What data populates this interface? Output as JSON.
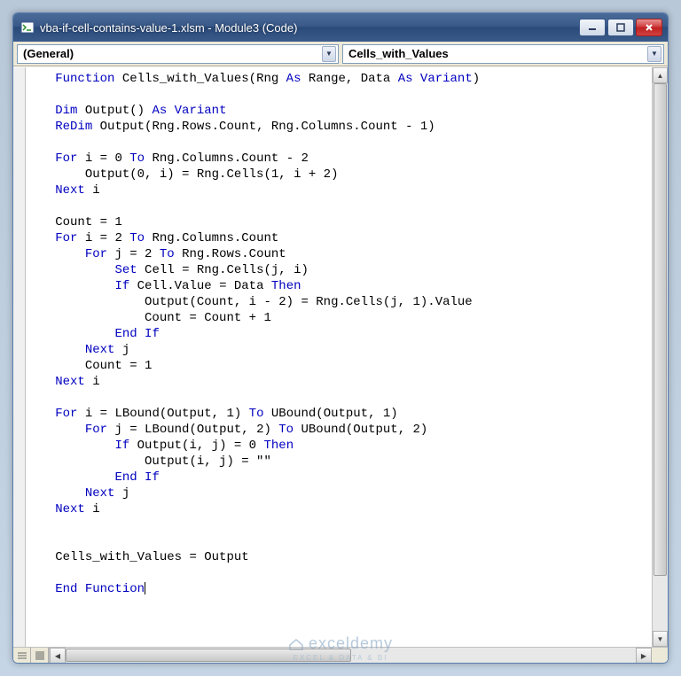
{
  "window": {
    "title": "vba-if-cell-contains-value-1.xlsm - Module3 (Code)"
  },
  "dropdowns": {
    "object": "(General)",
    "procedure": "Cells_with_Values"
  },
  "code": {
    "lines": [
      [
        [
          "kw",
          "Function"
        ],
        [
          "txt",
          " Cells_with_Values(Rng "
        ],
        [
          "kw",
          "As"
        ],
        [
          "txt",
          " Range, Data "
        ],
        [
          "kw",
          "As"
        ],
        [
          "txt",
          " "
        ],
        [
          "kw",
          "Variant"
        ],
        [
          "txt",
          ")"
        ]
      ],
      [],
      [
        [
          "kw",
          "Dim"
        ],
        [
          "txt",
          " Output() "
        ],
        [
          "kw",
          "As Variant"
        ]
      ],
      [
        [
          "kw",
          "ReDim"
        ],
        [
          "txt",
          " Output(Rng.Rows.Count, Rng.Columns.Count - 1)"
        ]
      ],
      [],
      [
        [
          "kw",
          "For"
        ],
        [
          "txt",
          " i = 0 "
        ],
        [
          "kw",
          "To"
        ],
        [
          "txt",
          " Rng.Columns.Count - 2"
        ]
      ],
      [
        [
          "txt",
          "    Output(0, i) = Rng.Cells(1, i + 2)"
        ]
      ],
      [
        [
          "kw",
          "Next"
        ],
        [
          "txt",
          " i"
        ]
      ],
      [],
      [
        [
          "txt",
          "Count = 1"
        ]
      ],
      [
        [
          "kw",
          "For"
        ],
        [
          "txt",
          " i = 2 "
        ],
        [
          "kw",
          "To"
        ],
        [
          "txt",
          " Rng.Columns.Count"
        ]
      ],
      [
        [
          "txt",
          "    "
        ],
        [
          "kw",
          "For"
        ],
        [
          "txt",
          " j = 2 "
        ],
        [
          "kw",
          "To"
        ],
        [
          "txt",
          " Rng.Rows.Count"
        ]
      ],
      [
        [
          "txt",
          "        "
        ],
        [
          "kw",
          "Set"
        ],
        [
          "txt",
          " Cell = Rng.Cells(j, i)"
        ]
      ],
      [
        [
          "txt",
          "        "
        ],
        [
          "kw",
          "If"
        ],
        [
          "txt",
          " Cell.Value = Data "
        ],
        [
          "kw",
          "Then"
        ]
      ],
      [
        [
          "txt",
          "            Output(Count, i - 2) = Rng.Cells(j, 1).Value"
        ]
      ],
      [
        [
          "txt",
          "            Count = Count + 1"
        ]
      ],
      [
        [
          "txt",
          "        "
        ],
        [
          "kw",
          "End If"
        ]
      ],
      [
        [
          "txt",
          "    "
        ],
        [
          "kw",
          "Next"
        ],
        [
          "txt",
          " j"
        ]
      ],
      [
        [
          "txt",
          "    Count = 1"
        ]
      ],
      [
        [
          "kw",
          "Next"
        ],
        [
          "txt",
          " i"
        ]
      ],
      [],
      [
        [
          "kw",
          "For"
        ],
        [
          "txt",
          " i = LBound(Output, 1) "
        ],
        [
          "kw",
          "To"
        ],
        [
          "txt",
          " UBound(Output, 1)"
        ]
      ],
      [
        [
          "txt",
          "    "
        ],
        [
          "kw",
          "For"
        ],
        [
          "txt",
          " j = LBound(Output, 2) "
        ],
        [
          "kw",
          "To"
        ],
        [
          "txt",
          " UBound(Output, 2)"
        ]
      ],
      [
        [
          "txt",
          "        "
        ],
        [
          "kw",
          "If"
        ],
        [
          "txt",
          " Output(i, j) = 0 "
        ],
        [
          "kw",
          "Then"
        ]
      ],
      [
        [
          "txt",
          "            Output(i, j) = \"\""
        ]
      ],
      [
        [
          "txt",
          "        "
        ],
        [
          "kw",
          "End If"
        ]
      ],
      [
        [
          "txt",
          "    "
        ],
        [
          "kw",
          "Next"
        ],
        [
          "txt",
          " j"
        ]
      ],
      [
        [
          "kw",
          "Next"
        ],
        [
          "txt",
          " i"
        ]
      ],
      [],
      [],
      [
        [
          "txt",
          "Cells_with_Values = Output"
        ]
      ],
      [],
      [
        [
          "kw",
          "End Function"
        ]
      ]
    ]
  },
  "watermark": {
    "brand": "exceldemy",
    "sub": "EXCEL & DATA & BI"
  }
}
